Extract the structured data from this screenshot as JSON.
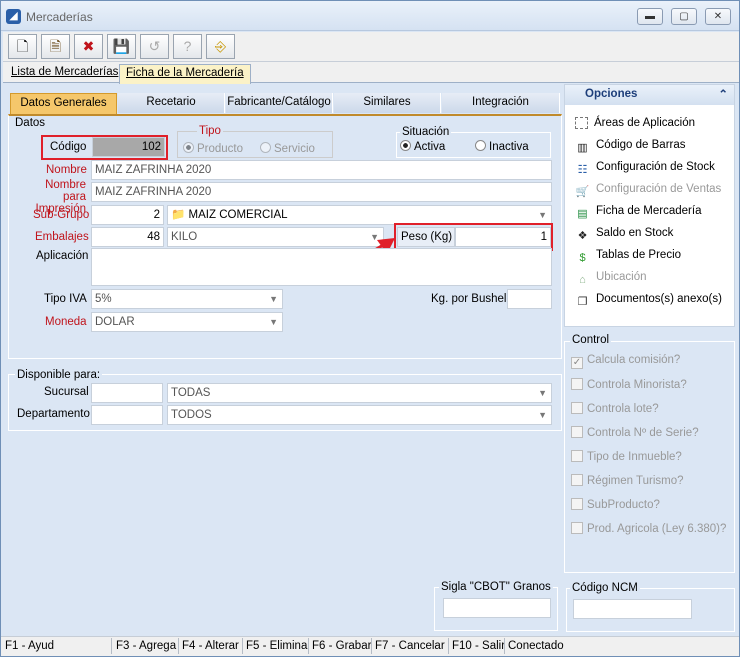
{
  "window": {
    "title": "Mercaderías",
    "minimize": "▬",
    "maximize": "▢",
    "close": "✕"
  },
  "toolbar": {
    "new": "🗋",
    "edit": "🗎",
    "delete": "✖",
    "save": "💾",
    "undo": "↺",
    "help": "?",
    "exit": "⎆"
  },
  "main_tabs": [
    "Lista de Mercaderías",
    "Ficha de la Mercadería"
  ],
  "sub_tabs": [
    "Datos Generales",
    "Recetario",
    "Fabricante/Catálogo",
    "Similares",
    "Integración"
  ],
  "datos": {
    "section": "Datos",
    "codigo_label": "Código",
    "codigo": "102",
    "tipo_label": "Tipo",
    "tipo_producto": "Producto",
    "tipo_servicio": "Servicio",
    "situacion_label": "Situación",
    "activa": "Activa",
    "inactiva": "Inactiva",
    "nombre_label": "Nombre",
    "nombre": "MAIZ ZAFRINHA 2020",
    "nombre_imp_label": "Nombre para Impresión",
    "nombre_imp": "MAIZ ZAFRINHA 2020",
    "subgrupo_label": "Sub-Grupo",
    "subgrupo_num": "2",
    "subgrupo": "MAIZ COMERCIAL",
    "embalajes_label": "Embalajes",
    "embalajes_num": "48",
    "embalaje": "KILO",
    "peso_label": "Peso (Kg)",
    "peso": "1",
    "aplicacion_label": "Aplicación",
    "aplicacion": "",
    "tipo_iva_label": "Tipo IVA",
    "tipo_iva": "5%",
    "kg_bushel_label": "Kg. por Bushel",
    "kg_bushel": "",
    "moneda_label": "Moneda",
    "moneda": "DOLAR"
  },
  "disponible": {
    "section": "Disponible para:",
    "sucursal_label": "Sucursal",
    "sucursal": "TODAS",
    "departamento_label": "Departamento",
    "departamento": "TODOS"
  },
  "sigla_label": "Sigla \"CBOT\" Granos",
  "ncm_label": "Código NCM",
  "opciones": {
    "title": "Opciones",
    "items": [
      {
        "label": "Áreas de Aplicación",
        "icon": "area-icon",
        "enabled": true
      },
      {
        "label": "Código de Barras",
        "icon": "barcode-icon",
        "enabled": true
      },
      {
        "label": "Configuración de Stock",
        "icon": "stock-config-icon",
        "enabled": true
      },
      {
        "label": "Configuración de Ventas",
        "icon": "cart-icon",
        "enabled": false
      },
      {
        "label": "Ficha de Mercadería",
        "icon": "sheet-icon",
        "enabled": true
      },
      {
        "label": "Saldo en Stock",
        "icon": "boxes-icon",
        "enabled": true
      },
      {
        "label": "Tablas de Precio",
        "icon": "price-icon",
        "enabled": true
      },
      {
        "label": "Ubicación",
        "icon": "location-icon",
        "enabled": false
      },
      {
        "label": "Documentos(s) anexo(s)",
        "icon": "documents-icon",
        "enabled": true
      }
    ]
  },
  "control": {
    "title": "Control",
    "items": [
      {
        "label": "Calcula comisión?",
        "checked": true
      },
      {
        "label": "Controla Minorista?",
        "checked": false
      },
      {
        "label": "Controla lote?",
        "checked": false
      },
      {
        "label": "Controla Nº de Serie?",
        "checked": false
      },
      {
        "label": "Tipo de Inmueble?",
        "checked": false
      },
      {
        "label": "Régimen Turismo?",
        "checked": false
      },
      {
        "label": "SubProducto?",
        "checked": false
      },
      {
        "label": "Prod. Agricola (Ley 6.380)?",
        "checked": false
      }
    ]
  },
  "status": [
    "F1 - Ayud",
    "F3 - Agrega",
    "F4 - Alterar",
    "F5 - Elimina",
    "F6 - Grabar",
    "F7 - Cancelar",
    "F10 - Salir",
    "Conectado"
  ]
}
